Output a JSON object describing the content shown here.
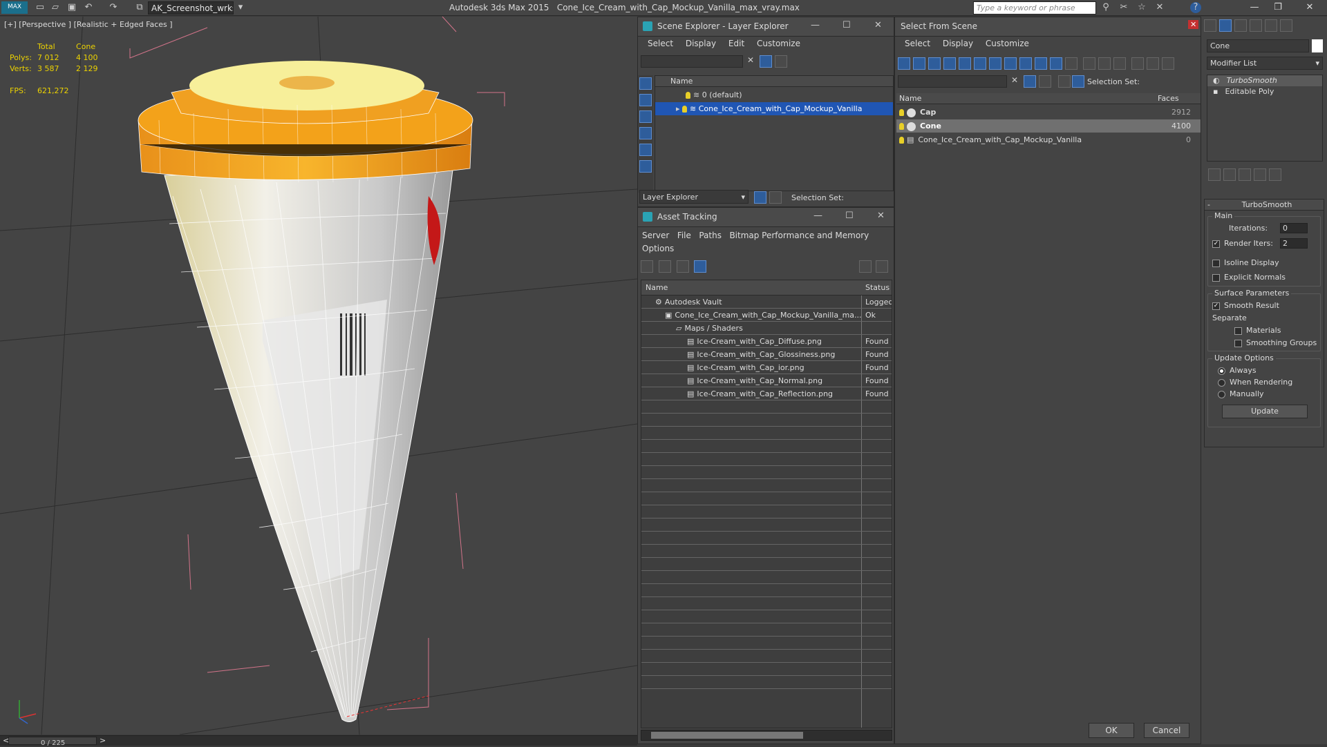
{
  "titlebar": {
    "app_logo": "MAX",
    "workspace": "AK_Screenshot_wrksp",
    "app_name": "Autodesk 3ds Max  2015",
    "file_name": "Cone_Ice_Cream_with_Cap_Mockup_Vanilla_max_vray.max",
    "search_placeholder": "Type a keyword or phrase",
    "icons": [
      "new-icon",
      "open-icon",
      "save-icon",
      "undo-icon",
      "redo-icon",
      "project-icon"
    ],
    "window_controls": [
      "minimize-icon",
      "restore-icon",
      "close-icon"
    ]
  },
  "viewport": {
    "label": "[+] [Perspective ] [Realistic + Edged Faces ]",
    "stats": {
      "col_total": "Total",
      "col_cone": "Cone",
      "polys_label": "Polys:",
      "polys_total": "7 012",
      "polys_cone": "4 100",
      "verts_label": "Verts:",
      "verts_total": "3 587",
      "verts_cone": "2 129",
      "fps_label": "FPS:",
      "fps_value": "621,272"
    }
  },
  "timeline": {
    "frame": "0 / 225",
    "prev": "<",
    "next": ">"
  },
  "scene_explorer": {
    "title": "Scene Explorer - Layer Explorer",
    "menu": [
      "Select",
      "Display",
      "Edit",
      "Customize"
    ],
    "column": "Name",
    "rows": [
      "0 (default)",
      "Cone_Ice_Cream_with_Cap_Mockup_Vanilla"
    ],
    "footer_dropdown": "Layer Explorer",
    "selection_set": "Selection Set:"
  },
  "asset_tracking": {
    "title": "Asset Tracking",
    "menu": [
      "Server",
      "File",
      "Paths",
      "Bitmap Performance and Memory",
      "Options"
    ],
    "col_name": "Name",
    "col_status": "Status",
    "rows": [
      {
        "name": "Autodesk Vault",
        "status": "Logged"
      },
      {
        "name": "Cone_Ice_Cream_with_Cap_Mockup_Vanilla_ma...",
        "status": "Ok"
      },
      {
        "name": "Maps / Shaders",
        "status": ""
      },
      {
        "name": "Ice-Cream_with_Cap_Diffuse.png",
        "status": "Found"
      },
      {
        "name": "Ice-Cream_with_Cap_Glossiness.png",
        "status": "Found"
      },
      {
        "name": "Ice-Cream_with_Cap_ior.png",
        "status": "Found"
      },
      {
        "name": "Ice-Cream_with_Cap_Normal.png",
        "status": "Found"
      },
      {
        "name": "Ice-Cream_with_Cap_Reflection.png",
        "status": "Found"
      }
    ]
  },
  "select_from_scene": {
    "title": "Select From Scene",
    "menu": [
      "Select",
      "Display",
      "Customize"
    ],
    "selection_set": "Selection Set:",
    "col_name": "Name",
    "col_faces": "Faces",
    "rows": [
      {
        "name": "Cap",
        "faces": "2912"
      },
      {
        "name": "Cone",
        "faces": "4100"
      },
      {
        "name": "Cone_Ice_Cream_with_Cap_Mockup_Vanilla",
        "faces": "0"
      }
    ],
    "ok": "OK",
    "cancel": "Cancel"
  },
  "modify_panel": {
    "object_name": "Cone",
    "modifier_list": "Modifier List",
    "stack": [
      "TurboSmooth",
      "Editable Poly"
    ],
    "rollout_title": "TurboSmooth",
    "main": "Main",
    "iterations_label": "Iterations:",
    "iterations_value": "0",
    "render_iters_label": "Render Iters:",
    "render_iters_value": "2",
    "isoline": "Isoline Display",
    "explicit_normals": "Explicit Normals",
    "surface_params": "Surface Parameters",
    "smooth_result": "Smooth Result",
    "separate": "Separate",
    "materials": "Materials",
    "smoothing_groups": "Smoothing Groups",
    "update_options": "Update Options",
    "always": "Always",
    "when_rendering": "When Rendering",
    "manually": "Manually",
    "update_button": "Update"
  },
  "colors": {
    "selection": "#2056b4",
    "stats_text": "#ecd200",
    "cap_orange": "#f3a21a"
  }
}
